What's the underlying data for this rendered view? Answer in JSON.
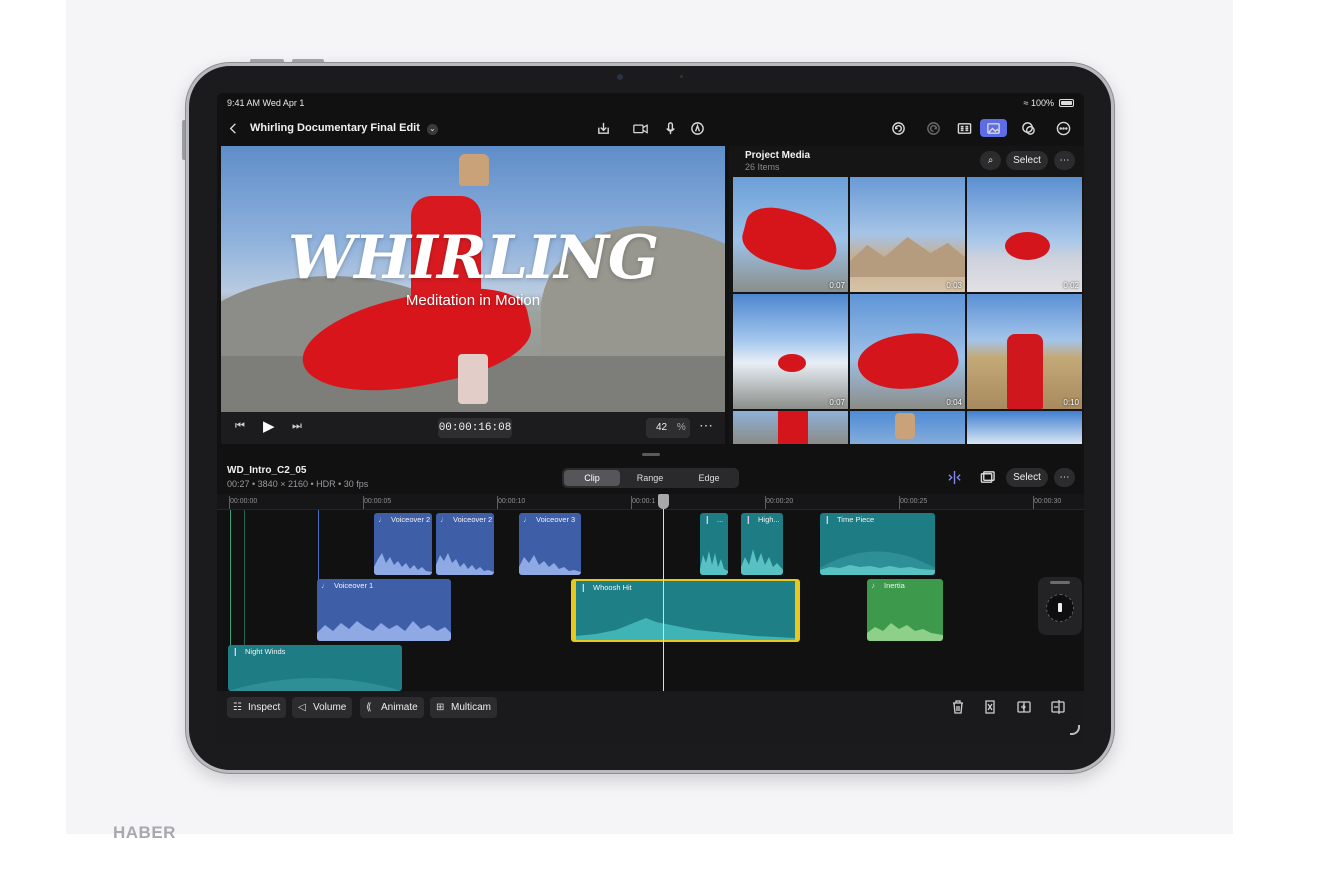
{
  "watermark": "HABER",
  "status_bar": {
    "time": "9:41 AM",
    "date": "Wed Apr 1",
    "battery": "100%"
  },
  "toolbar": {
    "project_title": "Whirling Documentary Final Edit",
    "icons": [
      "back-icon",
      "chevron-down-icon",
      "import-icon",
      "camera-icon",
      "microphone-icon",
      "pen-icon",
      "undo-icon",
      "redo-icon",
      "inspector-icon",
      "photos-icon",
      "effects-icon",
      "more-icon"
    ]
  },
  "viewer": {
    "title": "WHIRLING",
    "subtitle": "Meditation in Motion",
    "timecode": "00:00:16:08",
    "zoom": "42",
    "zoom_unit": "%"
  },
  "media": {
    "title": "Project Media",
    "count": "26 Items",
    "select_label": "Select",
    "thumbnails": [
      {
        "duration": "0:07"
      },
      {
        "duration": "0:03"
      },
      {
        "duration": "0:02"
      },
      {
        "duration": "0:07"
      },
      {
        "duration": "0:04"
      },
      {
        "duration": "0:10"
      }
    ]
  },
  "timeline": {
    "clip_name": "WD_Intro_C2_05",
    "clip_meta": "00:27 • 3840 × 2160 • HDR • 30 fps",
    "segments": [
      "Clip",
      "Range",
      "Edge"
    ],
    "selected_segment": "Clip",
    "select_label": "Select",
    "ruler": [
      "00:00:00",
      "00:00:05",
      "00:00:10",
      "00:00:1",
      "00:00:20",
      "00:00:25",
      "00:00:30"
    ],
    "clips": {
      "vo2a": "Voiceover 2",
      "vo2b": "Voiceover 2",
      "vo3": "Voiceover 3",
      "dash": "...",
      "high": "High...",
      "time_piece": "Time Piece",
      "vo1": "Voiceover 1",
      "whoosh": "Whoosh Hit",
      "inertia": "Inertia",
      "night": "Night Winds"
    }
  },
  "bottom_bar": {
    "inspect": "Inspect",
    "volume": "Volume",
    "animate": "Animate",
    "multicam": "Multicam"
  }
}
